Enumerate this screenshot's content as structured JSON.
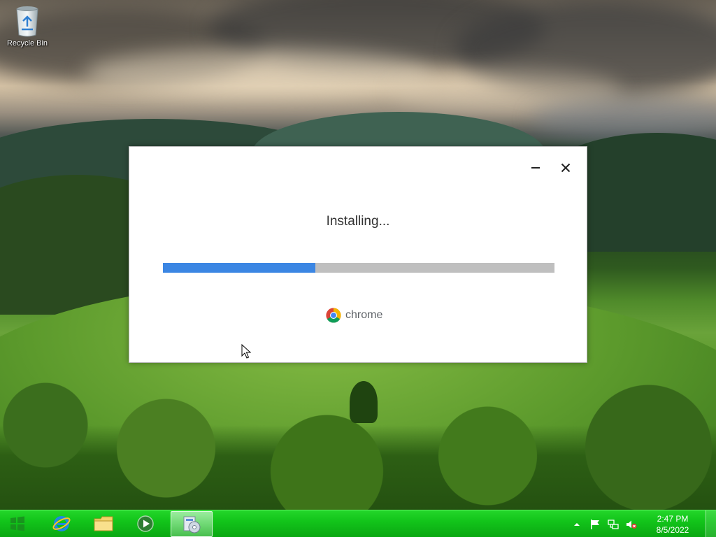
{
  "desktop": {
    "icons": [
      {
        "label": "Recycle Bin",
        "icon": "recycle-bin-icon"
      }
    ]
  },
  "installer": {
    "status_text": "Installing...",
    "progress_percent": 39,
    "brand_name": "chrome",
    "brand_icon": "chrome-logo-icon",
    "minimize_icon": "minimize-icon",
    "close_icon": "close-icon",
    "colors": {
      "progress_fill": "#3b86e3",
      "progress_track": "#bfbfbf"
    }
  },
  "taskbar": {
    "pinned": [
      {
        "name": "start",
        "icon": "windows-logo-icon"
      },
      {
        "name": "internet-explorer",
        "icon": "ie-icon"
      },
      {
        "name": "file-explorer",
        "icon": "folder-icon"
      },
      {
        "name": "media-player",
        "icon": "media-player-icon"
      },
      {
        "name": "installer",
        "icon": "installer-icon",
        "active": true
      }
    ],
    "tray_icons": [
      "chevron-up-icon",
      "flag-icon",
      "network-icon",
      "volume-muted-icon"
    ],
    "clock": {
      "time": "2:47 PM",
      "date": "8/5/2022"
    },
    "color": "#12c41a"
  }
}
